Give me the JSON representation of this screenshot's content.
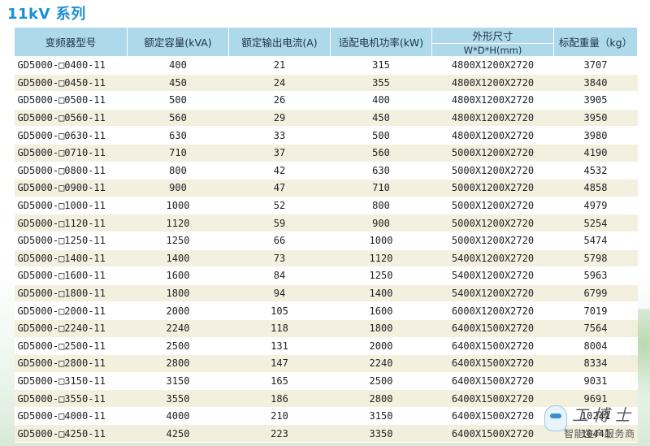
{
  "title": "11kV 系列",
  "table": {
    "headers": {
      "model": "变频器型号",
      "capacity": "额定容量(kVA)",
      "current": "额定输出电流(A)",
      "motor_power": "适配电机功率(kW)",
      "dimensions": "外形尺寸",
      "dimensions_unit": "W*D*H(mm)",
      "weight": "标配重量（kg）"
    },
    "rows": [
      {
        "model": "GD5000-□0400-11",
        "capacity": "400",
        "current": "21",
        "motor_power": "315",
        "dimensions": "4800X1200X2720",
        "weight": "3707"
      },
      {
        "model": "GD5000-□0450-11",
        "capacity": "450",
        "current": "24",
        "motor_power": "355",
        "dimensions": "4800X1200X2720",
        "weight": "3840"
      },
      {
        "model": "GD5000-□0500-11",
        "capacity": "500",
        "current": "26",
        "motor_power": "400",
        "dimensions": "4800X1200X2720",
        "weight": "3905"
      },
      {
        "model": "GD5000-□0560-11",
        "capacity": "560",
        "current": "29",
        "motor_power": "450",
        "dimensions": "4800X1200X2720",
        "weight": "3950"
      },
      {
        "model": "GD5000-□0630-11",
        "capacity": "630",
        "current": "33",
        "motor_power": "500",
        "dimensions": "4800X1200X2720",
        "weight": "3980"
      },
      {
        "model": "GD5000-□0710-11",
        "capacity": "710",
        "current": "37",
        "motor_power": "560",
        "dimensions": "5000X1200X2720",
        "weight": "4190"
      },
      {
        "model": "GD5000-□0800-11",
        "capacity": "800",
        "current": "42",
        "motor_power": "630",
        "dimensions": "5000X1200X2720",
        "weight": "4532"
      },
      {
        "model": "GD5000-□0900-11",
        "capacity": "900",
        "current": "47",
        "motor_power": "710",
        "dimensions": "5000X1200X2720",
        "weight": "4858"
      },
      {
        "model": "GD5000-□1000-11",
        "capacity": "1000",
        "current": "52",
        "motor_power": "800",
        "dimensions": "5000X1200X2720",
        "weight": "4979"
      },
      {
        "model": "GD5000-□1120-11",
        "capacity": "1120",
        "current": "59",
        "motor_power": "900",
        "dimensions": "5000X1200X2720",
        "weight": "5254"
      },
      {
        "model": "GD5000-□1250-11",
        "capacity": "1250",
        "current": "66",
        "motor_power": "1000",
        "dimensions": "5000X1200X2720",
        "weight": "5474"
      },
      {
        "model": "GD5000-□1400-11",
        "capacity": "1400",
        "current": "73",
        "motor_power": "1120",
        "dimensions": "5400X1200X2720",
        "weight": "5798"
      },
      {
        "model": "GD5000-□1600-11",
        "capacity": "1600",
        "current": "84",
        "motor_power": "1250",
        "dimensions": "5400X1200X2720",
        "weight": "5963"
      },
      {
        "model": "GD5000-□1800-11",
        "capacity": "1800",
        "current": "94",
        "motor_power": "1400",
        "dimensions": "5400X1200X2720",
        "weight": "6799"
      },
      {
        "model": "GD5000-□2000-11",
        "capacity": "2000",
        "current": "105",
        "motor_power": "1600",
        "dimensions": "6000X1200X2720",
        "weight": "7019"
      },
      {
        "model": "GD5000-□2240-11",
        "capacity": "2240",
        "current": "118",
        "motor_power": "1800",
        "dimensions": "6400X1500X2720",
        "weight": "7564"
      },
      {
        "model": "GD5000-□2500-11",
        "capacity": "2500",
        "current": "131",
        "motor_power": "2000",
        "dimensions": "6400X1500X2720",
        "weight": "8004"
      },
      {
        "model": "GD5000-□2800-11",
        "capacity": "2800",
        "current": "147",
        "motor_power": "2240",
        "dimensions": "6400X1500X2720",
        "weight": "8334"
      },
      {
        "model": "GD5000-□3150-11",
        "capacity": "3150",
        "current": "165",
        "motor_power": "2500",
        "dimensions": "6400X1500X2720",
        "weight": "9031"
      },
      {
        "model": "GD5000-□3550-11",
        "capacity": "3550",
        "current": "186",
        "motor_power": "2800",
        "dimensions": "6400X1500X2720",
        "weight": "9691"
      },
      {
        "model": "GD5000-□4000-11",
        "capacity": "4000",
        "current": "210",
        "motor_power": "3150",
        "dimensions": "6400X1500X2720",
        "weight": "10241"
      },
      {
        "model": "GD5000-□4250-11",
        "capacity": "4250",
        "current": "223",
        "motor_power": "3350",
        "dimensions": "6400X1500X2720",
        "weight": "10441"
      }
    ]
  },
  "watermark": {
    "logo_text": "工博士",
    "subtitle": "智能生产服务商"
  },
  "colors": {
    "title": "#1a8fd4",
    "header_bg": "#aed9ea",
    "row_alt": "#f3efdd"
  }
}
